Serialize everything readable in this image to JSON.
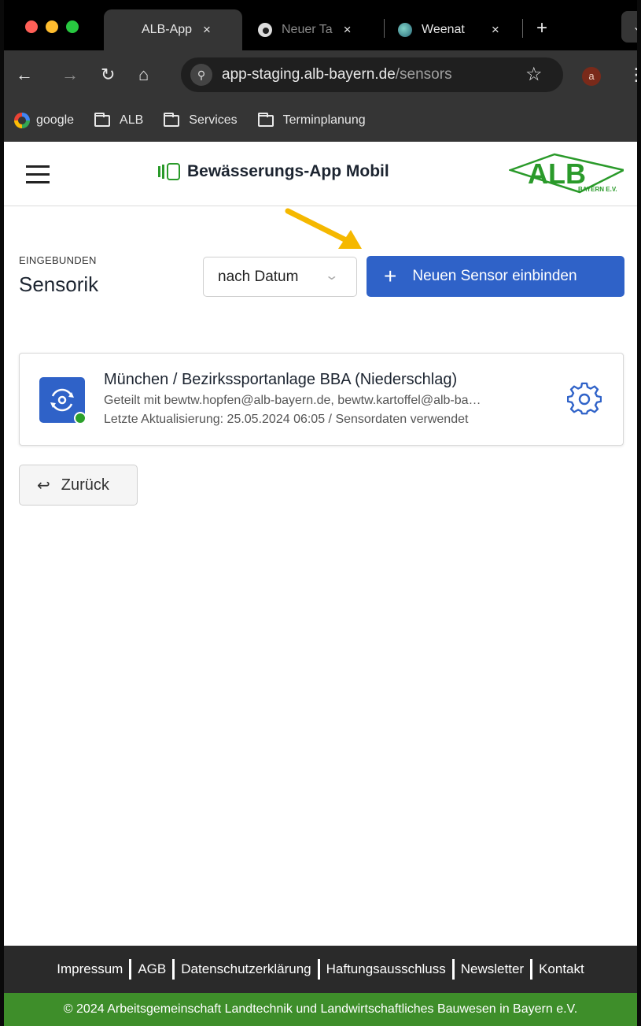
{
  "browser": {
    "tabs": [
      {
        "title": "ALB-App",
        "close": "×"
      },
      {
        "title": "Neuer Ta",
        "close": "×"
      },
      {
        "title": "Weenat",
        "close": "×"
      }
    ],
    "new_tab": "+",
    "address": {
      "domain": "app-staging.alb-bayern.de",
      "path": "/sensors"
    },
    "profile_initial": "a",
    "bookmarks": [
      "google",
      "ALB",
      "Services",
      "Terminplanung"
    ]
  },
  "header": {
    "title": "Bewässerungs-App Mobil",
    "logo": {
      "text": "ALB",
      "subtext": "BAYERN E.V."
    }
  },
  "main": {
    "kicker": "EINGEBUNDEN",
    "title": "Sensorik",
    "sort_value": "nach Datum",
    "add_button": "Neuen Sensor einbinden",
    "sensors": [
      {
        "name": "München / Bezirkssportanlage BBA (Niederschlag)",
        "shared": "Geteilt mit bewtw.hopfen@alb-bayern.de, bewtw.kartoffel@alb-ba…",
        "updated": "Letzte Aktualisierung: 25.05.2024 06:05 / Sensordaten verwendet",
        "status": "online"
      }
    ],
    "back_button": "Zurück"
  },
  "footer": {
    "links": [
      "Impressum",
      "AGB",
      "Datenschutzerklärung",
      "Haftungsausschluss",
      "Newsletter",
      "Kontakt"
    ],
    "copyright": "© 2024 Arbeitsgemeinschaft Landtechnik und Landwirtschaftliches Bauwesen in Bayern e.V."
  },
  "colors": {
    "primary": "#2f62c8",
    "brand_green": "#3e8e2a",
    "status_online": "#2aa02a",
    "annotation_arrow": "#f5b800"
  }
}
